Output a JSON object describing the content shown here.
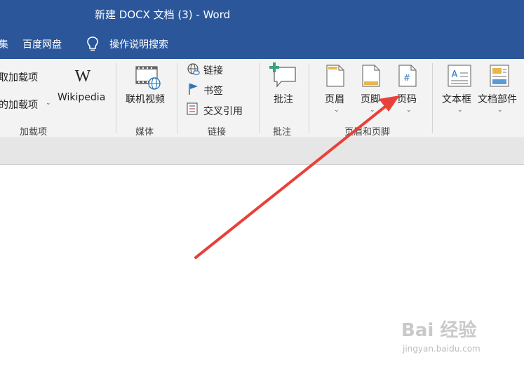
{
  "window": {
    "title": "新建 DOCX 文档 (3)  -  Word"
  },
  "menubar": {
    "items": [
      "集",
      "百度网盘"
    ],
    "search_label": "操作说明搜索"
  },
  "ribbon": {
    "addins": {
      "item1": "取加载项",
      "item2": "的加载项",
      "wikipedia": "Wikipedia",
      "group_label": "加载项"
    },
    "media": {
      "online_video": "联机视频",
      "group_label": "媒体"
    },
    "links": {
      "link": "链接",
      "bookmark": "书签",
      "cross_reference": "交叉引用",
      "group_label": "链接"
    },
    "comments": {
      "comment": "批注",
      "group_label": "批注"
    },
    "header_footer": {
      "header": "页眉",
      "footer": "页脚",
      "page_number": "页码",
      "group_label": "页眉和页脚"
    },
    "text": {
      "textbox": "文本框",
      "quick_parts": "文档部件"
    }
  },
  "watermark": {
    "logo": "Bai 经验",
    "url": "jingyan.baidu.com"
  },
  "colors": {
    "title_bar": "#2b579a",
    "ribbon_bg": "#f3f3f3",
    "arrow": "#e8413a"
  },
  "icons": [
    "lightbulb-icon",
    "wikipedia-icon",
    "online-video-icon",
    "link-icon",
    "bookmark-icon",
    "cross-reference-icon",
    "comment-icon",
    "header-icon",
    "footer-icon",
    "page-number-icon",
    "textbox-icon",
    "quick-parts-icon"
  ]
}
